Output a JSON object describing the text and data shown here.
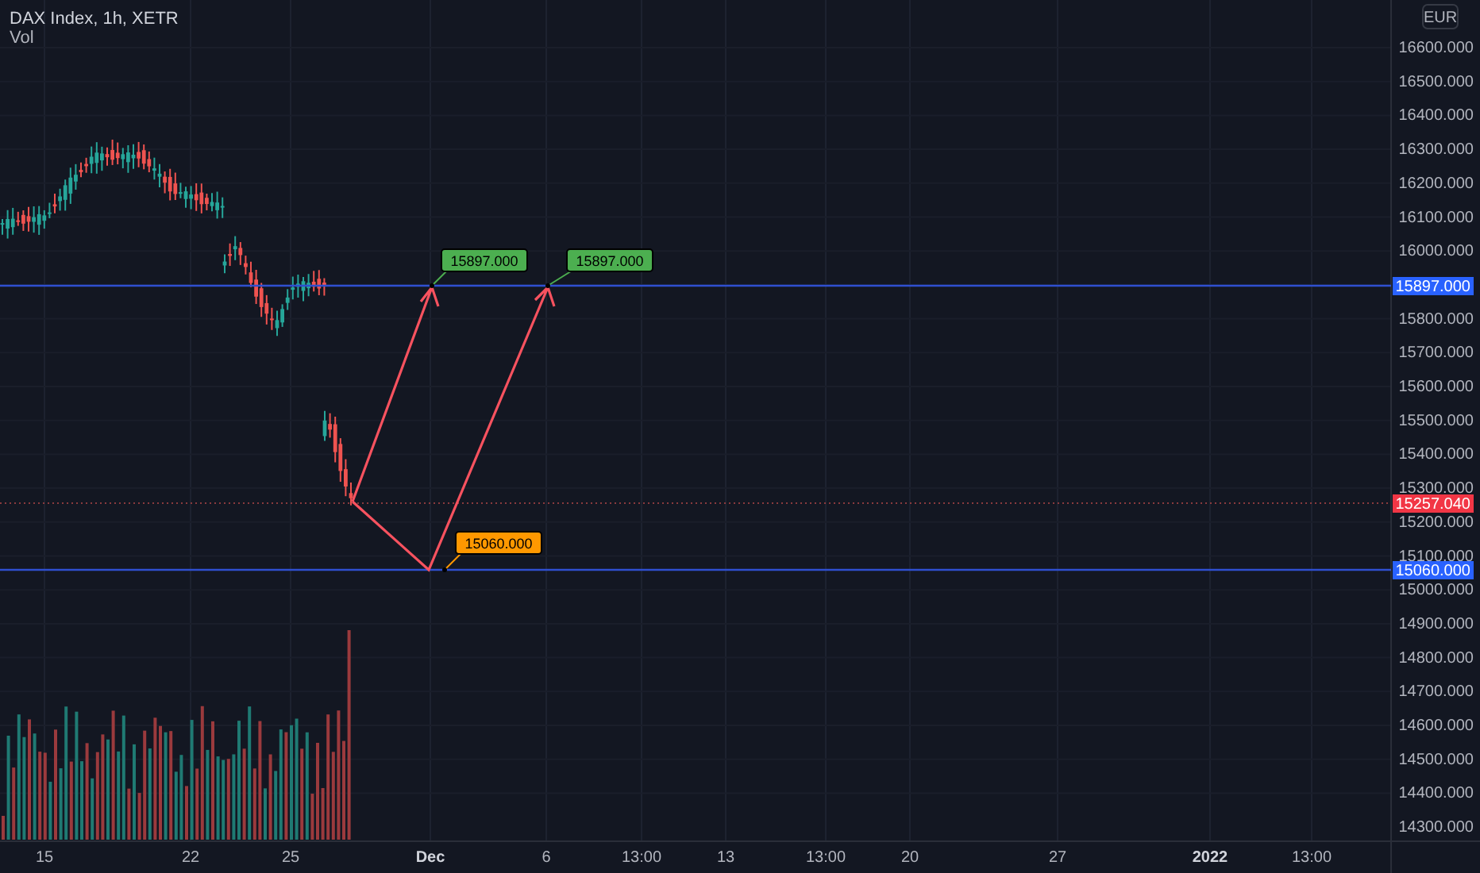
{
  "header": {
    "title": "DAX Index, 1h, XETR",
    "legend": "Vol"
  },
  "currency_button": "EUR",
  "price_axis": {
    "ticks": [
      "16600.000",
      "16500.000",
      "16400.000",
      "16300.000",
      "16200.000",
      "16100.000",
      "16000.000",
      "15800.000",
      "15700.000",
      "15600.000",
      "15500.000",
      "15400.000",
      "15300.000",
      "15200.000",
      "15100.000",
      "15000.000",
      "14900.000",
      "14800.000",
      "14700.000",
      "14600.000",
      "14500.000",
      "14400.000",
      "14300.000"
    ]
  },
  "price_tags": [
    {
      "text": "15897.000",
      "color": "#2962ff"
    },
    {
      "text": "15257.040",
      "color": "#f23645"
    },
    {
      "text": "15060.000",
      "color": "#2962ff"
    }
  ],
  "callouts": [
    {
      "text": "15897.000",
      "color": "#4caf50"
    },
    {
      "text": "15897.000",
      "color": "#4caf50"
    },
    {
      "text": "15060.000",
      "color": "#ff9800"
    }
  ],
  "time_axis": {
    "ticks": [
      {
        "label": "15",
        "major": false
      },
      {
        "label": "22",
        "major": false
      },
      {
        "label": "25",
        "major": false
      },
      {
        "label": "Dec",
        "major": true
      },
      {
        "label": "6",
        "major": false
      },
      {
        "label": "13:00",
        "major": false
      },
      {
        "label": "13",
        "major": false
      },
      {
        "label": "13:00",
        "major": false
      },
      {
        "label": "20",
        "major": false
      },
      {
        "label": "27",
        "major": false
      },
      {
        "label": "2022",
        "major": true
      },
      {
        "label": "13:00",
        "major": false
      }
    ]
  }
}
